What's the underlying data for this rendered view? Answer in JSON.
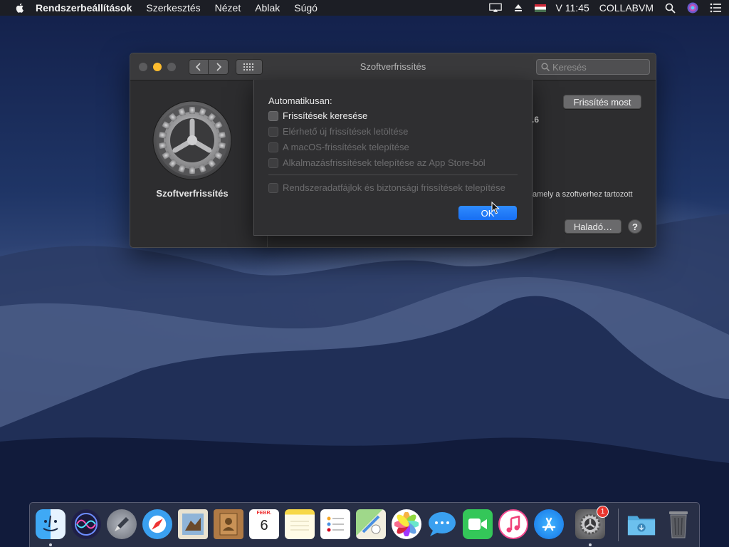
{
  "menubar": {
    "app_name": "Rendszerbeállítások",
    "menus": [
      "Szerkesztés",
      "Nézet",
      "Ablak",
      "Súgó"
    ],
    "clock": "V 11:45",
    "user": "COLLABVM"
  },
  "window": {
    "title": "Szoftverfrissítés",
    "search_placeholder": "Keresés",
    "pane_label": "Szoftverfrissítés",
    "update_now_label": "Frissítés most",
    "version_fragment": ".6",
    "background_fragment": "amely a szoftverhez tartozott",
    "advanced_label": "Haladó…",
    "help_label": "?"
  },
  "sheet": {
    "heading": "Automatikusan:",
    "options": [
      {
        "label": "Frissítések keresése",
        "checked": false,
        "enabled": true
      },
      {
        "label": "Elérhető új frissítések letöltése",
        "checked": false,
        "enabled": false
      },
      {
        "label": "A macOS-frissítések telepítése",
        "checked": false,
        "enabled": false
      },
      {
        "label": "Alkalmazásfrissítések telepítése az App Store-ból",
        "checked": false,
        "enabled": false
      },
      {
        "label": "Rendszeradatfájlok és biztonsági frissítések telepítése",
        "checked": false,
        "enabled": false
      }
    ],
    "ok_label": "OK"
  },
  "dock": {
    "calendar_month": "FEBR.",
    "calendar_day": "6",
    "prefs_badge": "1",
    "apps": [
      "finder-icon",
      "siri-icon",
      "launchpad-icon",
      "safari-icon",
      "mail-icon",
      "contacts-icon",
      "calendar-icon",
      "notes-icon",
      "reminders-icon",
      "maps-icon",
      "photos-icon",
      "messages-icon",
      "facetime-icon",
      "itunes-icon",
      "app-store-icon",
      "system-preferences-icon",
      "downloads-folder-icon",
      "trash-icon"
    ]
  },
  "colors": {
    "accent": "#176ef2",
    "window_bg": "#2d2d2f",
    "minimize": "#fdbc2e"
  }
}
